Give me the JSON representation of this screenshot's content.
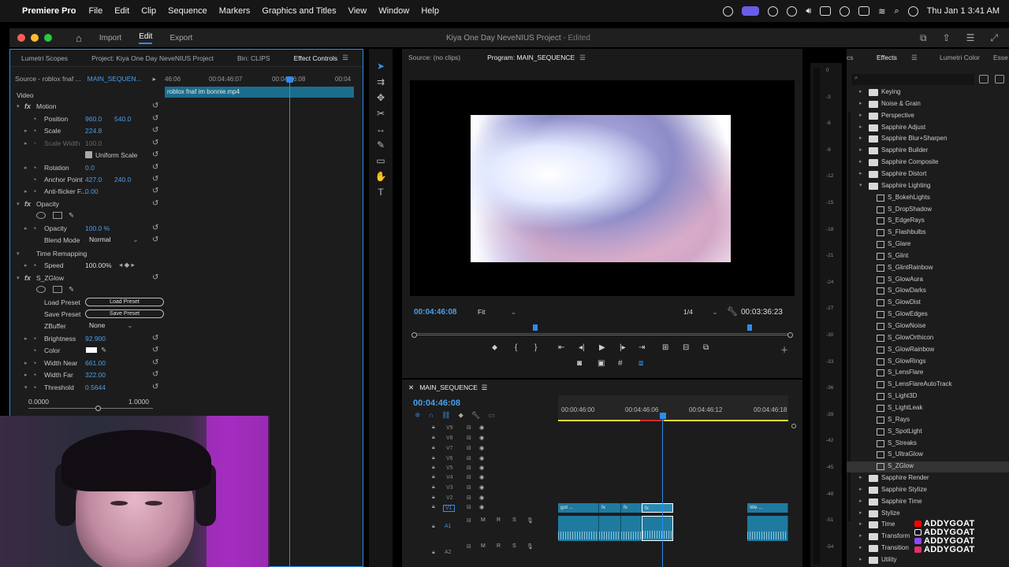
{
  "menubar": {
    "app": "Premiere Pro",
    "items": [
      "File",
      "Edit",
      "Clip",
      "Sequence",
      "Markers",
      "Graphics and Titles",
      "View",
      "Window",
      "Help"
    ],
    "datetime": "Thu Jan 1  3:41 AM"
  },
  "titlebar": {
    "workspaces": [
      "Import",
      "Edit",
      "Export"
    ],
    "project": "Kiya One Day NeveNIUS Project",
    "edited": " - Edited"
  },
  "effect_controls": {
    "tabs": [
      "Lumetri Scopes",
      "Project: Kiya One Day NeveNIUS Project",
      "Bin: CLIPS",
      "Effect Controls"
    ],
    "source": "Source - roblox fnaf ...",
    "sequence": "MAIN_SEQUEN...",
    "ruler": [
      "46:06",
      "00:04:46:07",
      "00:04:46:08",
      "00:04"
    ],
    "clip": "roblox fnaf im bonnie.mp4",
    "section_video": "Video",
    "motion": "Motion",
    "position_label": "Position",
    "position_x": "960.0",
    "position_y": "540.0",
    "scale_label": "Scale",
    "scale": "224.8",
    "scale_width_label": "Scale Width",
    "scale_width": "100.0",
    "uniform_label": "Uniform Scale",
    "rotation_label": "Rotation",
    "rotation": "0.0",
    "anchor_label": "Anchor Point",
    "anchor_x": "427.0",
    "anchor_y": "240.0",
    "antiflicker_label": "Anti-flicker F...",
    "antiflicker": "0.00",
    "opacity_section": "Opacity",
    "opacity_label": "Opacity",
    "opacity": "100.0 %",
    "blend_label": "Blend Mode",
    "blend": "Normal",
    "time_remap": "Time Remapping",
    "speed_label": "Speed",
    "speed": "100.00%",
    "zglow": "S_ZGlow",
    "load_preset_label": "Load Preset",
    "load_preset_btn": "Load Preset",
    "save_preset_label": "Save Preset",
    "save_preset_btn": "Save Preset",
    "zbuffer_label": "ZBuffer",
    "zbuffer": "None",
    "brightness_label": "Brightness",
    "brightness": "92.900",
    "color_label": "Color",
    "width_near_label": "Width Near",
    "width_near": "661.00",
    "width_far_label": "Width Far",
    "width_far": "322.00",
    "threshold_label": "Threshold",
    "threshold": "0.5644",
    "slider_min": "0.0000",
    "slider_max": "1.0000",
    "threshold_fraction": 0.5644
  },
  "program": {
    "source_tab": "Source: (no clips)",
    "program_tab": "Program: MAIN_SEQUENCE",
    "timecode": "00:04:46:08",
    "fit": "Fit",
    "resolution": "1/4",
    "duration": "00:03:36:23"
  },
  "timeline": {
    "title": "MAIN_SEQUENCE",
    "timecode": "00:04:46:08",
    "ruler": [
      "00:00:46:00",
      "00:04:46:06",
      "00:04:46:12",
      "00:04:46:18"
    ],
    "video_tracks": [
      "V9",
      "V8",
      "V7",
      "V6",
      "V5",
      "V4",
      "V3",
      "V2",
      "V1"
    ],
    "audio_tracks": [
      "A1",
      "A2"
    ],
    "clip_labels": [
      "got ...",
      "We ..."
    ],
    "track_buttons": [
      "M",
      "R",
      "S"
    ]
  },
  "effects": {
    "tabs": [
      "cs",
      "Effects",
      "Lumetri Color",
      "Esse"
    ],
    "items": [
      {
        "label": "Keying",
        "type": "folder"
      },
      {
        "label": "Noise & Grain",
        "type": "folder"
      },
      {
        "label": "Perspective",
        "type": "folder"
      },
      {
        "label": "Sapphire Adjust",
        "type": "folder"
      },
      {
        "label": "Sapphire Blur+Sharpen",
        "type": "folder"
      },
      {
        "label": "Sapphire Builder",
        "type": "folder"
      },
      {
        "label": "Sapphire Composite",
        "type": "folder"
      },
      {
        "label": "Sapphire Distort",
        "type": "folder"
      },
      {
        "label": "Sapphire Lighting",
        "type": "open"
      },
      {
        "label": "S_BokehLights",
        "type": "fx"
      },
      {
        "label": "S_DropShadow",
        "type": "fx"
      },
      {
        "label": "S_EdgeRays",
        "type": "fx"
      },
      {
        "label": "S_Flashbulbs",
        "type": "fx"
      },
      {
        "label": "S_Glare",
        "type": "fx"
      },
      {
        "label": "S_Glint",
        "type": "fx"
      },
      {
        "label": "S_GlintRainbow",
        "type": "fx"
      },
      {
        "label": "S_GlowAura",
        "type": "fx"
      },
      {
        "label": "S_GlowDarks",
        "type": "fx"
      },
      {
        "label": "S_GlowDist",
        "type": "fx"
      },
      {
        "label": "S_GlowEdges",
        "type": "fx"
      },
      {
        "label": "S_GlowNoise",
        "type": "fx"
      },
      {
        "label": "S_GlowOrthicon",
        "type": "fx"
      },
      {
        "label": "S_GlowRainbow",
        "type": "fx"
      },
      {
        "label": "S_GlowRings",
        "type": "fx"
      },
      {
        "label": "S_LensFlare",
        "type": "fx"
      },
      {
        "label": "S_LensFlareAutoTrack",
        "type": "fx"
      },
      {
        "label": "S_Light3D",
        "type": "fx"
      },
      {
        "label": "S_LightLeak",
        "type": "fx"
      },
      {
        "label": "S_Rays",
        "type": "fx"
      },
      {
        "label": "S_SpotLight",
        "type": "fx"
      },
      {
        "label": "S_Streaks",
        "type": "fx"
      },
      {
        "label": "S_UltraGlow",
        "type": "fx"
      },
      {
        "label": "S_ZGlow",
        "type": "fx",
        "selected": true
      },
      {
        "label": "Sapphire Render",
        "type": "folder"
      },
      {
        "label": "Sapphire Stylize",
        "type": "folder"
      },
      {
        "label": "Sapphire Time",
        "type": "folder"
      },
      {
        "label": "Stylize",
        "type": "folder"
      },
      {
        "label": "Time",
        "type": "folder"
      },
      {
        "label": "Transform",
        "type": "folder"
      },
      {
        "label": "Transition",
        "type": "folder"
      },
      {
        "label": "Utility",
        "type": "folder"
      }
    ]
  },
  "meter": [
    "0",
    "-3",
    "-6",
    "-9",
    "-12",
    "-15",
    "-18",
    "-21",
    "-24",
    "-27",
    "-30",
    "-33",
    "-36",
    "-39",
    "-42",
    "-45",
    "-48",
    "-51",
    "-54"
  ],
  "watermark": [
    "ADDYGOAT",
    "ADDYGOAT",
    "ADDYGOAT",
    "ADDYGOAT"
  ],
  "colors": {
    "accent": "#2d8ceb",
    "value": "#4a9fe8",
    "clip": "#1f7aa0",
    "work_area": "#e3df2c"
  }
}
